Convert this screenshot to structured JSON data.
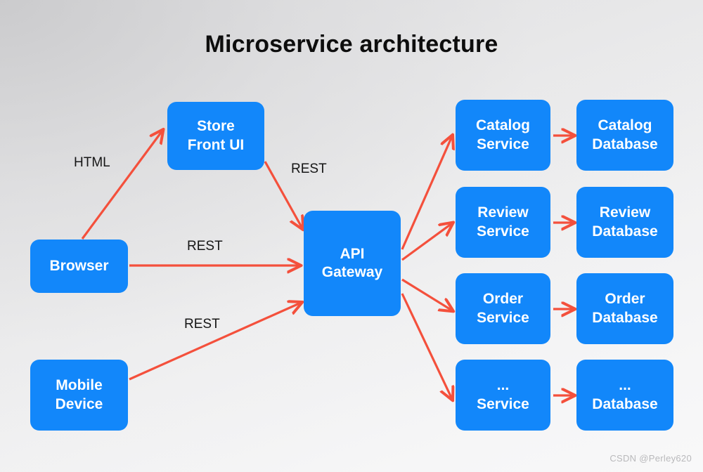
{
  "title": "Microservice architecture",
  "colors": {
    "node_fill": "#1287fa",
    "node_text": "#ffffff",
    "arrow": "#f4503c",
    "title_text": "#0d0d0d",
    "label_text": "#161616",
    "background_top_left": "#dcdcdd",
    "background_bottom": "#f6f6f7",
    "watermark_text": "#b9b9bb"
  },
  "nodes": {
    "store_front_ui": {
      "line1": "Store",
      "line2": "Front UI"
    },
    "browser": {
      "line1": "Browser",
      "line2": ""
    },
    "mobile_device": {
      "line1": "Mobile",
      "line2": "Device"
    },
    "api_gateway": {
      "line1": "API",
      "line2": "Gateway"
    },
    "catalog_service": {
      "line1": "Catalog",
      "line2": "Service"
    },
    "catalog_database": {
      "line1": "Catalog",
      "line2": "Database"
    },
    "review_service": {
      "line1": "Review",
      "line2": "Service"
    },
    "review_database": {
      "line1": "Review",
      "line2": "Database"
    },
    "order_service": {
      "line1": "Order",
      "line2": "Service"
    },
    "order_database": {
      "line1": "Order",
      "line2": "Database"
    },
    "other_service": {
      "line1": "...",
      "line2": "Service"
    },
    "other_database": {
      "line1": "...",
      "line2": "Database"
    }
  },
  "edge_labels": {
    "browser_to_store_front": "HTML",
    "store_front_to_gateway": "REST",
    "browser_to_gateway": "REST",
    "mobile_to_gateway": "REST"
  },
  "watermark": "CSDN @Perley620"
}
